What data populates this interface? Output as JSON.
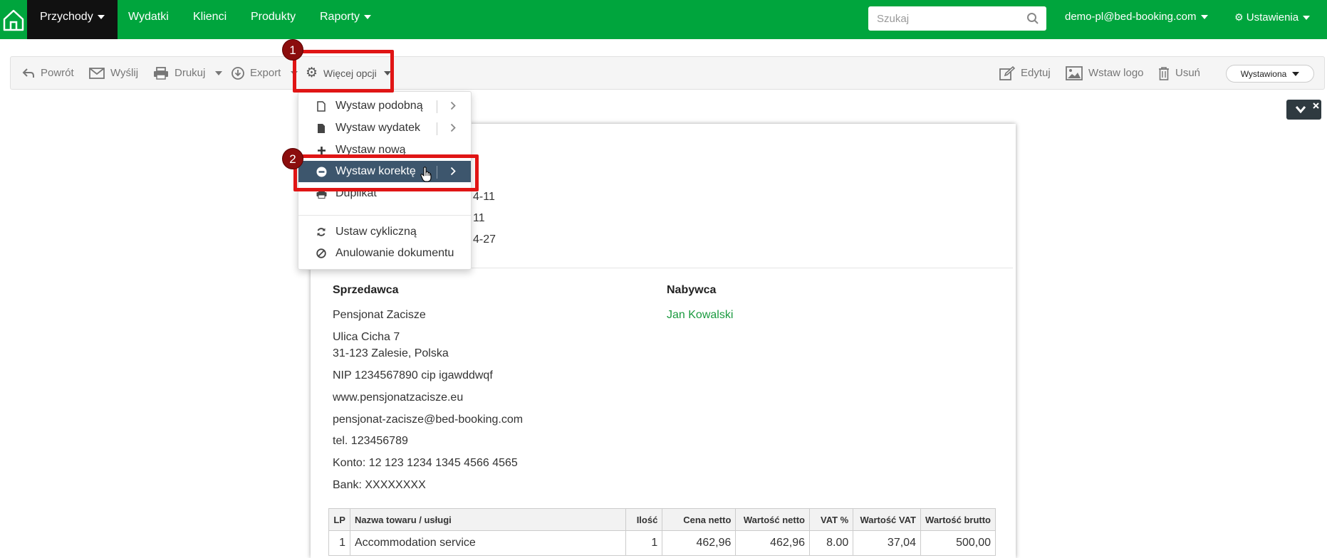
{
  "nav": {
    "items": [
      {
        "label": "Przychody",
        "dropdown": true,
        "active": true
      },
      {
        "label": "Wydatki"
      },
      {
        "label": "Klienci"
      },
      {
        "label": "Produkty"
      },
      {
        "label": "Raporty",
        "dropdown": true
      }
    ],
    "search_placeholder": "Szukaj",
    "account": "demo-pl@bed-booking.com",
    "settings": "Ustawienia"
  },
  "toolbar": {
    "back": "Powrót",
    "send": "Wyślij",
    "print": "Drukuj",
    "export": "Export",
    "more": "Więcej opcji",
    "edit": "Edytuj",
    "insert_logo": "Wstaw logo",
    "delete": "Usuń",
    "status": "Wystawiona"
  },
  "callouts": {
    "one": "1",
    "two": "2"
  },
  "menu": {
    "items": [
      {
        "label": "Wystaw podobną",
        "icon": "file-icon",
        "submenu": true
      },
      {
        "label": "Wystaw wydatek",
        "icon": "file-solid-icon",
        "submenu": true
      },
      {
        "label": "Wystaw nową",
        "icon": "plus-icon"
      },
      {
        "label": "Wystaw korektę",
        "icon": "minus-circle-icon",
        "submenu": true,
        "highlighted": true
      },
      {
        "label": "Duplikat",
        "icon": "print-icon"
      },
      {
        "label": "Ustaw cykliczną",
        "icon": "refresh-icon"
      },
      {
        "label": "Anulowanie dokumentu",
        "icon": "ban-icon"
      }
    ]
  },
  "document": {
    "meta_fragments": [
      "4-11",
      "11",
      "4-27"
    ],
    "seller": {
      "heading": "Sprzedawca",
      "name": "Pensjonat Zacisze",
      "street": "Ulica Cicha 7",
      "city": "31-123 Zalesie, Polska",
      "nip": "NIP 1234567890 cip igawddwqf",
      "website": "www.pensjonatzacisze.eu",
      "email": "pensjonat-zacisze@bed-booking.com",
      "phone": "tel. 123456789",
      "account": "Konto: 12 123 1234 1345 4566 4565",
      "bank": "Bank: XXXXXXXX"
    },
    "buyer": {
      "heading": "Nabywca",
      "name": "Jan Kowalski"
    },
    "table": {
      "headers": [
        "LP",
        "Nazwa towaru / usługi",
        "Ilość",
        "Cena netto",
        "Wartość netto",
        "VAT %",
        "Wartość VAT",
        "Wartość brutto"
      ],
      "rows": [
        [
          "1",
          "Accommodation service",
          "1",
          "462,96",
          "462,96",
          "8.00",
          "37,04",
          "500,00"
        ]
      ]
    }
  },
  "colors": {
    "brand_green": "#00a53d",
    "highlight": "#3d566d",
    "callout_red": "#e01515"
  }
}
